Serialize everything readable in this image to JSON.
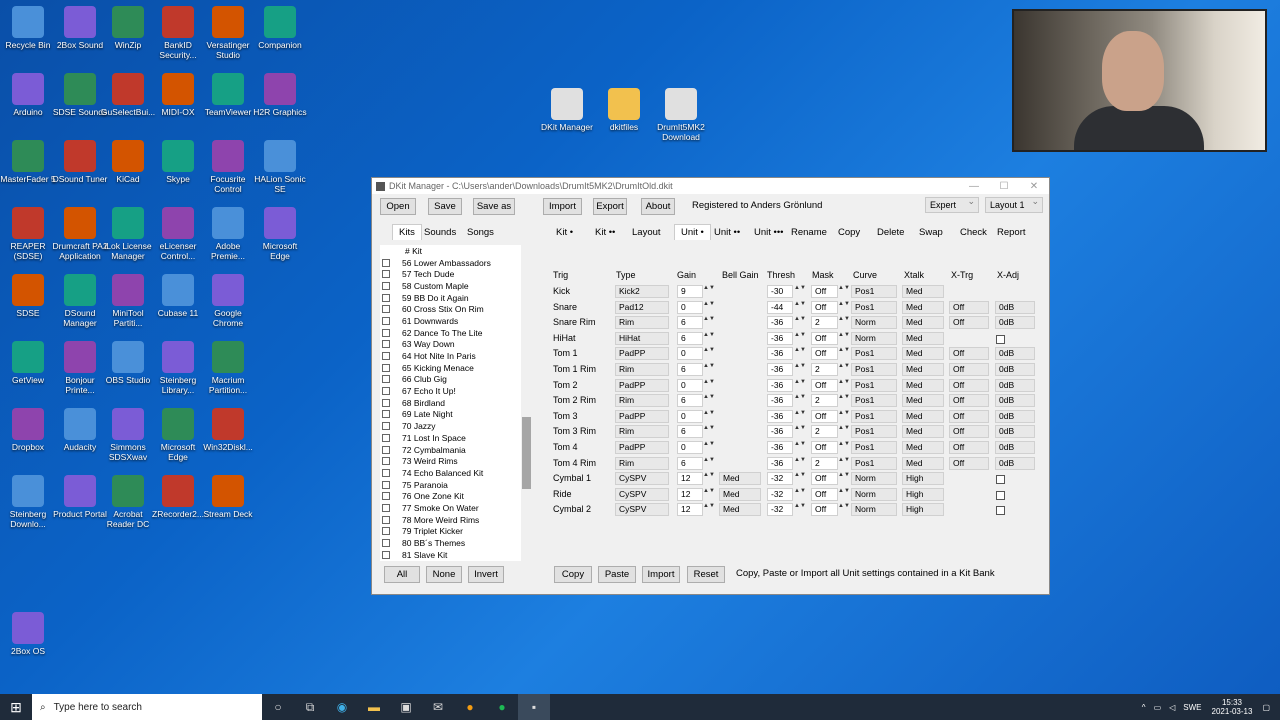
{
  "desktop": {
    "icons_col1": [
      "Recycle Bin",
      "Arduino",
      "MasterFader 5",
      "REAPER (SDSE)",
      "SDSE",
      "GetView",
      "Dropbox",
      "Steinberg Downlo...",
      "2Box OS"
    ],
    "icons_col2": [
      "2Box Sound",
      "SDSE Sounds",
      "DSound Tuner",
      "Drumcraft PA2 Application",
      "DSound Manager",
      "Bonjour Printe...",
      "Audacity",
      "Product Portal"
    ],
    "icons_col3": [
      "WinZip",
      "GuSelectBui...",
      "KiCad",
      "iLok License Manager",
      "MiniTool Partiti...",
      "OBS Studio",
      "Simmons SDSXwav",
      "Acrobat Reader DC"
    ],
    "icons_col4": [
      "BankID Security...",
      "MIDI-OX",
      "Skype",
      "eLicenser Control...",
      "Cubase 11",
      "Steinberg Library...",
      "Microsoft Edge",
      "ZRecorder2..."
    ],
    "icons_col5": [
      "Versatinger Studio",
      "TeamViewer",
      "Focusrite Control",
      "Adobe Premie...",
      "Google Chrome",
      "Macrium Partition...",
      "Win32Diskl...",
      "Stream Deck"
    ],
    "icons_col6": [
      "Companion",
      "H2R Graphics",
      "HALion Sonic SE",
      "Microsoft Edge"
    ],
    "icons_center": [
      "DKit Manager",
      "dkitfiles",
      "DrumIt5MK2 Download"
    ]
  },
  "window": {
    "title": "DKit Manager - C:\\Users\\ander\\Downloads\\DrumIt5MK2\\DrumItOld.dkit",
    "toolbar": {
      "open": "Open",
      "save": "Save",
      "save_as": "Save as",
      "import": "Import",
      "export": "Export",
      "about": "About",
      "registered": "Registered to Anders Grönlund",
      "mode": "Expert",
      "layout": "Layout 1"
    },
    "left_tabs": [
      "Kits",
      "Sounds",
      "Songs"
    ],
    "right_tabs": [
      "Kit •",
      "Kit ••",
      "Layout",
      "Unit •",
      "Unit ••",
      "Unit •••",
      "Rename",
      "Copy",
      "Delete",
      "Swap",
      "Check",
      "Report"
    ],
    "kit_header": "#  Kit",
    "kits": [
      "56 Lower Ambassadors",
      "57 Tech Dude",
      "58 Custom Maple",
      "59 BB Do it Again",
      "60 Cross Stix On Rim",
      "61 Downwards",
      "62 Dance To The Lite",
      "63 Way Down",
      "64 Hot Nite In Paris",
      "65 Kicking Menace",
      "66 Club Gig",
      "67 Echo It Up!",
      "68 Birdland",
      "69 Late Night",
      "70 Jazzy",
      "71 Lost In Space",
      "72 Cymbalmania",
      "73 Weird Rims",
      "74 Echo Balanced Kit",
      "75 Paranoia",
      "76 One Zone Kit",
      "77 Smoke On Water",
      "78 More Weird Rims",
      "79 Triplet Kicker",
      "80 BB´s Themes",
      "81 Slave Kit"
    ],
    "list_buttons": {
      "all": "All",
      "none": "None",
      "invert": "Invert"
    },
    "columns": [
      "Trig",
      "Type",
      "Gain",
      "Bell Gain",
      "Thresh",
      "Mask",
      "Curve",
      "Xtalk",
      "X-Trg",
      "X-Adj"
    ],
    "rows": [
      {
        "trig": "Kick",
        "type": "Kick2",
        "gain": "9",
        "bell": "",
        "thresh": "-30",
        "mask": "Off",
        "curve": "Pos1",
        "xtalk": "Med",
        "xtrg": "",
        "xadj": "",
        "cb": false
      },
      {
        "trig": "Snare",
        "type": "Pad12",
        "gain": "0",
        "bell": "",
        "thresh": "-44",
        "mask": "Off",
        "curve": "Pos1",
        "xtalk": "Med",
        "xtrg": "Off",
        "xadj": "0dB",
        "cb": false
      },
      {
        "trig": "Snare Rim",
        "type": "Rim",
        "gain": "6",
        "bell": "",
        "thresh": "-36",
        "mask": "2",
        "curve": "Norm",
        "xtalk": "Med",
        "xtrg": "Off",
        "xadj": "0dB",
        "cb": false
      },
      {
        "trig": "HiHat",
        "type": "HiHat",
        "gain": "6",
        "bell": "",
        "thresh": "-36",
        "mask": "Off",
        "curve": "Norm",
        "xtalk": "Med",
        "xtrg": "",
        "xadj": "",
        "cb": true
      },
      {
        "trig": "Tom 1",
        "type": "PadPP",
        "gain": "0",
        "bell": "",
        "thresh": "-36",
        "mask": "Off",
        "curve": "Pos1",
        "xtalk": "Med",
        "xtrg": "Off",
        "xadj": "0dB",
        "cb": false
      },
      {
        "trig": "Tom 1 Rim",
        "type": "Rim",
        "gain": "6",
        "bell": "",
        "thresh": "-36",
        "mask": "2",
        "curve": "Pos1",
        "xtalk": "Med",
        "xtrg": "Off",
        "xadj": "0dB",
        "cb": false
      },
      {
        "trig": "Tom 2",
        "type": "PadPP",
        "gain": "0",
        "bell": "",
        "thresh": "-36",
        "mask": "Off",
        "curve": "Pos1",
        "xtalk": "Med",
        "xtrg": "Off",
        "xadj": "0dB",
        "cb": false
      },
      {
        "trig": "Tom 2 Rim",
        "type": "Rim",
        "gain": "6",
        "bell": "",
        "thresh": "-36",
        "mask": "2",
        "curve": "Pos1",
        "xtalk": "Med",
        "xtrg": "Off",
        "xadj": "0dB",
        "cb": false
      },
      {
        "trig": "Tom 3",
        "type": "PadPP",
        "gain": "0",
        "bell": "",
        "thresh": "-36",
        "mask": "Off",
        "curve": "Pos1",
        "xtalk": "Med",
        "xtrg": "Off",
        "xadj": "0dB",
        "cb": false
      },
      {
        "trig": "Tom 3 Rim",
        "type": "Rim",
        "gain": "6",
        "bell": "",
        "thresh": "-36",
        "mask": "2",
        "curve": "Pos1",
        "xtalk": "Med",
        "xtrg": "Off",
        "xadj": "0dB",
        "cb": false
      },
      {
        "trig": "Tom 4",
        "type": "PadPP",
        "gain": "0",
        "bell": "",
        "thresh": "-36",
        "mask": "Off",
        "curve": "Pos1",
        "xtalk": "Med",
        "xtrg": "Off",
        "xadj": "0dB",
        "cb": false
      },
      {
        "trig": "Tom 4 Rim",
        "type": "Rim",
        "gain": "6",
        "bell": "",
        "thresh": "-36",
        "mask": "2",
        "curve": "Pos1",
        "xtalk": "Med",
        "xtrg": "Off",
        "xadj": "0dB",
        "cb": false
      },
      {
        "trig": "Cymbal 1",
        "type": "CySPV",
        "gain": "12",
        "bell": "Med",
        "thresh": "-32",
        "mask": "Off",
        "curve": "Norm",
        "xtalk": "High",
        "xtrg": "",
        "xadj": "",
        "cb": true
      },
      {
        "trig": "Ride",
        "type": "CySPV",
        "gain": "12",
        "bell": "Med",
        "thresh": "-32",
        "mask": "Off",
        "curve": "Norm",
        "xtalk": "High",
        "xtrg": "",
        "xadj": "",
        "cb": true
      },
      {
        "trig": "Cymbal 2",
        "type": "CySPV",
        "gain": "12",
        "bell": "Med",
        "thresh": "-32",
        "mask": "Off",
        "curve": "Norm",
        "xtalk": "High",
        "xtrg": "",
        "xadj": "",
        "cb": true
      }
    ],
    "bottom": {
      "copy": "Copy",
      "paste": "Paste",
      "import": "Import",
      "reset": "Reset",
      "hint": "Copy, Paste or Import all Unit settings contained in a Kit Bank"
    }
  },
  "taskbar": {
    "search_placeholder": "Type here to search",
    "lang": "SWE",
    "time": "15:33",
    "date": "2021-03-13"
  }
}
